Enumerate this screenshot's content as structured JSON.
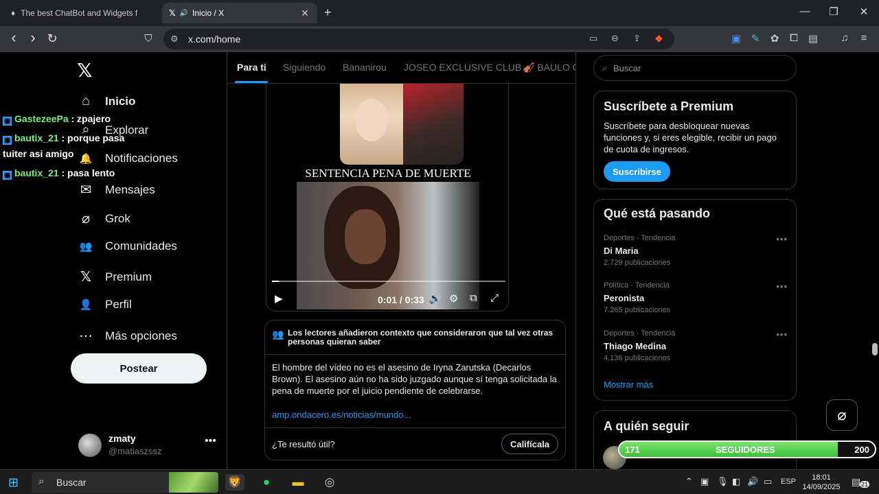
{
  "browser": {
    "tabs": [
      {
        "title": "The best ChatBot and Widgets for Kick",
        "active": false
      },
      {
        "title": "Inicio / X",
        "active": true
      }
    ],
    "new_tab": "+",
    "url": "x.com/home"
  },
  "icons": {
    "tab1": "♦",
    "tab2_x": "𝕏",
    "tab2_audio": "🔊",
    "close": "✕",
    "back": "‹",
    "forward": "›",
    "reload": "↻",
    "bookmark": "⛉",
    "site_info": "⚙",
    "minimize": "—",
    "maximize": "❐",
    "win_close": "✕",
    "home": "⌂",
    "search": "⌕",
    "bell": "🔔",
    "mail": "✉",
    "grok": "⌀",
    "communities": "👥",
    "premium": "𝕏",
    "profile": "👤",
    "more_options": "⋯",
    "play": "▶",
    "volume": "🔊",
    "settings": "⚙",
    "pip": "⧉",
    "fullscreen": "⤢",
    "notes": "👥",
    "windows": "⊞",
    "brave": "🦁"
  },
  "chat": [
    {
      "user": "GastezeePa",
      "message": ": zpajero"
    },
    {
      "user": "bautix_21",
      "message": ": porque pasa"
    },
    {
      "user": "",
      "message": "tuiter asi amigo"
    },
    {
      "user": "bautix_21",
      "message": ": pasa lento"
    }
  ],
  "nav": {
    "logo": "𝕏",
    "items": [
      "Inicio",
      "Explorar",
      "Notificaciones",
      "Mensajes",
      "Grok",
      "Comunidades",
      "Premium",
      "Perfil",
      "Más opciones"
    ],
    "post_button": "Postear"
  },
  "account": {
    "name": "zmaty",
    "handle": "@matiaszssz",
    "more": "•••"
  },
  "feed_tabs": [
    "Para ti",
    "Siguiendo",
    "Bananirou",
    "JOSEO EXCLUSIVE CLUB",
    "🎻 BAULO CLUB"
  ],
  "video": {
    "caption": "SENTENCIA PENA DE MUERTE",
    "time": "0:01 / 0:33",
    "progress": 0.03
  },
  "community_note": {
    "header": "Los lectores añadieron contexto que consideraron que tal vez otras personas quieran saber",
    "body": "El hombre del vídeo no es el asesino de Iryna Zarutska (Decarlos Brown). El asesino aún no ha sido juzgado aunque sí tenga solicitada la pena de muerte por el juicio pendiente de celebrarse.",
    "link": "amp.ondacero.es/noticias/mundo...",
    "question": "¿Te resultó útil?",
    "rate_button": "Califícala"
  },
  "search": {
    "placeholder": "Buscar"
  },
  "premium": {
    "title": "Suscríbete a Premium",
    "description": "Suscríbete para desbloquear nuevas funciones y, si eres elegible, recibir un pago de cuota de ingresos.",
    "button": "Suscribirse"
  },
  "trends": {
    "title": "Qué está pasando",
    "items": [
      {
        "category": "Deportes · Tendencia",
        "name": "Di Maria",
        "count": "2.729 publicaciones"
      },
      {
        "category": "Política · Tendencia",
        "name": "Peronista",
        "count": "7.265 publicaciones"
      },
      {
        "category": "Deportes · Tendencia",
        "name": "Thiago Medina",
        "count": "4.136 publicaciones"
      }
    ],
    "show_more": "Mostrar más",
    "more_icon": "•••"
  },
  "who_to_follow": {
    "title": "A quién seguir"
  },
  "followers_goal": {
    "current": "171",
    "label": "SEGUIDORES",
    "goal": "200",
    "progress": 0.855
  },
  "taskbar": {
    "search": "Buscar",
    "language": "ESP",
    "time": "18:01",
    "date": "14/09/2025",
    "notifications": "21"
  }
}
